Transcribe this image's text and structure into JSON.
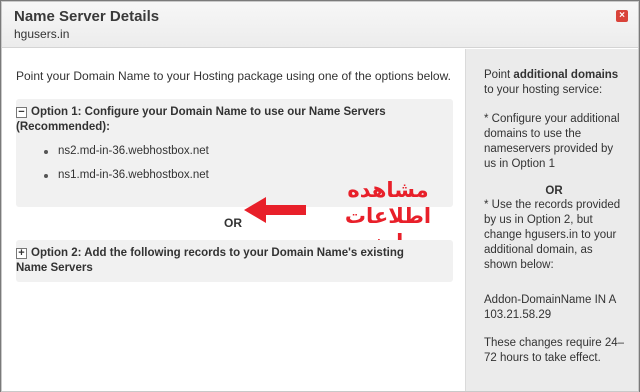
{
  "header": {
    "title": "Name Server Details",
    "subtitle": "hgusers.in",
    "close_label": "×"
  },
  "main": {
    "intro": "Point your Domain Name to your Hosting package using one of the options below.",
    "option1": {
      "toggle": "−",
      "title": "Option 1: Configure your Domain Name to use our Name Servers (Recommended):",
      "nameservers": [
        "ns2.md-in-36.webhostbox.net",
        "ns1.md-in-36.webhostbox.net"
      ]
    },
    "or_label": "OR",
    "option2": {
      "toggle": "+",
      "title": "Option 2: Add the following records to your Domain Name's existing Name Servers"
    },
    "annotation": {
      "line1": "مشاهده اطلاعات",
      "line2": "دامنه",
      "color": "#e8202a"
    }
  },
  "sidebar": {
    "p1_prefix": "Point ",
    "p1_bold": "additional domains",
    "p1_suffix": " to your hosting service:",
    "p2": "* Configure your additional domains to use the nameservers provided by us in Option 1",
    "or_label": "OR",
    "p3": "* Use the records provided by us in Option 2, but change hgusers.in to your additional domain, as shown below:",
    "p4": "Addon-DomainName IN A 103.21.58.29",
    "p5": "These changes require 24–72 hours to take effect."
  }
}
